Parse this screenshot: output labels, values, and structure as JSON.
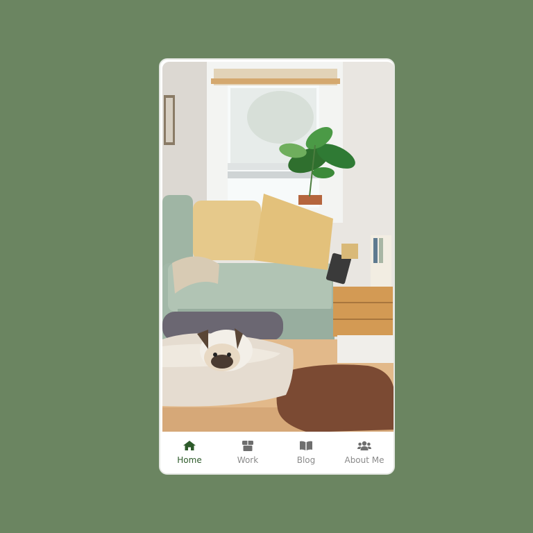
{
  "hero": {
    "alt": "Living room with sofa, plant and dog"
  },
  "colors": {
    "background": "#6b8561",
    "active_tab": "#2d5a2a",
    "inactive_tab": "#8a8a8a"
  },
  "tabs": [
    {
      "label": "Home",
      "icon": "home-icon",
      "active": true
    },
    {
      "label": "Work",
      "icon": "box-icon",
      "active": false
    },
    {
      "label": "Blog",
      "icon": "book-icon",
      "active": false
    },
    {
      "label": "About Me",
      "icon": "users-icon",
      "active": false
    }
  ]
}
